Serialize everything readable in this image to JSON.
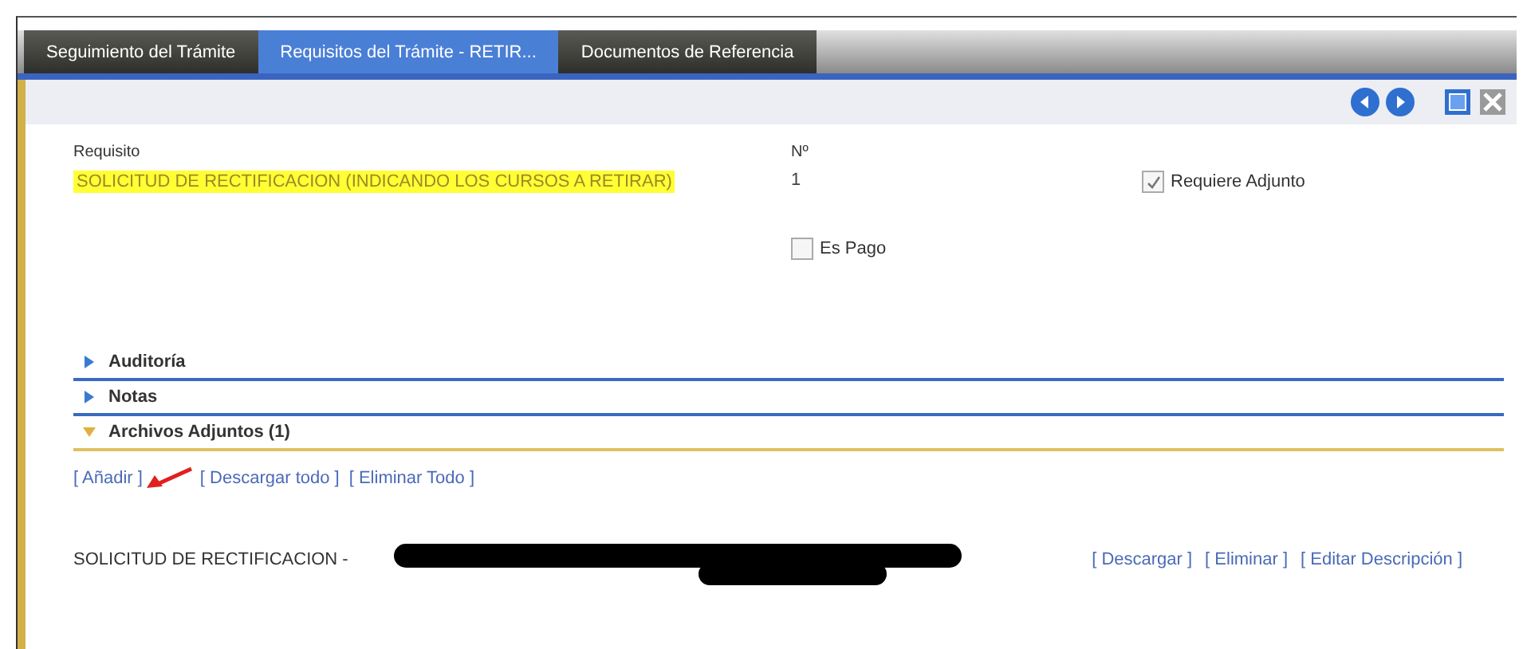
{
  "tabs": [
    {
      "label": "Seguimiento del Trámite",
      "selected": false
    },
    {
      "label": "Requisitos del Trámite - RETIR...",
      "selected": true
    },
    {
      "label": "Documentos de Referencia",
      "selected": false
    }
  ],
  "form": {
    "requisito_label": "Requisito",
    "requisito_value": "SOLICITUD DE RECTIFICACION (INDICANDO LOS CURSOS A RETIRAR)",
    "numero_label": "Nº",
    "numero_value": "1",
    "checkboxes": [
      {
        "label": "Requiere Adjunto",
        "checked": true
      },
      {
        "label": "Es Pago",
        "checked": false
      }
    ]
  },
  "sections": [
    {
      "title": "Auditoría",
      "expanded": false
    },
    {
      "title": "Notas",
      "expanded": false
    },
    {
      "title": "Archivos Adjuntos (1)",
      "expanded": true
    }
  ],
  "attachment_actions": [
    "[ Añadir ]",
    "[ Descargar todo ]",
    "[ Eliminar Todo ]"
  ],
  "files": [
    {
      "name": "SOLICITUD DE RECTIFICACION -",
      "actions": [
        "[ Descargar ]",
        "[ Eliminar ]",
        "[ Editar Descripción ]"
      ]
    }
  ]
}
